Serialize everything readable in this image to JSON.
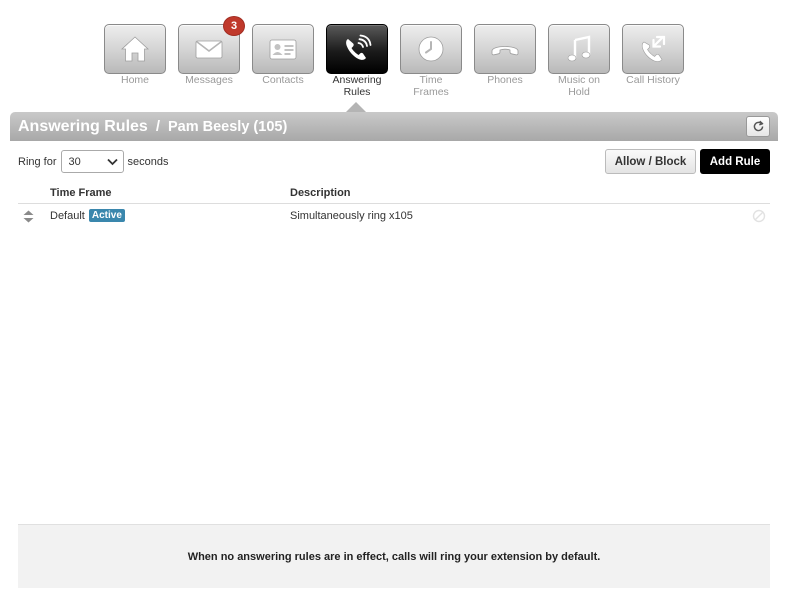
{
  "nav": {
    "items": [
      {
        "id": "home",
        "label": "Home",
        "icon": "home-icon",
        "active": false
      },
      {
        "id": "messages",
        "label": "Messages",
        "icon": "envelope-icon",
        "active": false,
        "badge": "3"
      },
      {
        "id": "contacts",
        "label": "Contacts",
        "icon": "contact-card-icon",
        "active": false
      },
      {
        "id": "answering-rules",
        "label": "Answering\nRules",
        "icon": "phone-ringing-icon",
        "active": true
      },
      {
        "id": "time-frames",
        "label": "Time\nFrames",
        "icon": "clock-icon",
        "active": false
      },
      {
        "id": "phones",
        "label": "Phones",
        "icon": "handset-icon",
        "active": false
      },
      {
        "id": "music-on-hold",
        "label": "Music on\nHold",
        "icon": "music-note-icon",
        "active": false
      },
      {
        "id": "call-history",
        "label": "Call History",
        "icon": "call-history-icon",
        "active": false
      }
    ]
  },
  "header": {
    "title": "Answering Rules",
    "separator": "/",
    "subtitle": "Pam Beesly (105)"
  },
  "controls": {
    "ring_for_label": "Ring for",
    "ring_value": "30",
    "seconds_label": "seconds",
    "allow_block_label": "Allow / Block",
    "add_rule_label": "Add Rule"
  },
  "table": {
    "columns": {
      "time_frame": "Time Frame",
      "description": "Description"
    },
    "rows": [
      {
        "time_frame": "Default",
        "status": "Active",
        "description": "Simultaneously ring x105"
      }
    ]
  },
  "footer": {
    "note": "When no answering rules are in effect, calls will ring your extension by default."
  },
  "colors": {
    "badge_red": "#c0392b",
    "status_blue": "#3a87ad",
    "primary_button": "#000000"
  }
}
